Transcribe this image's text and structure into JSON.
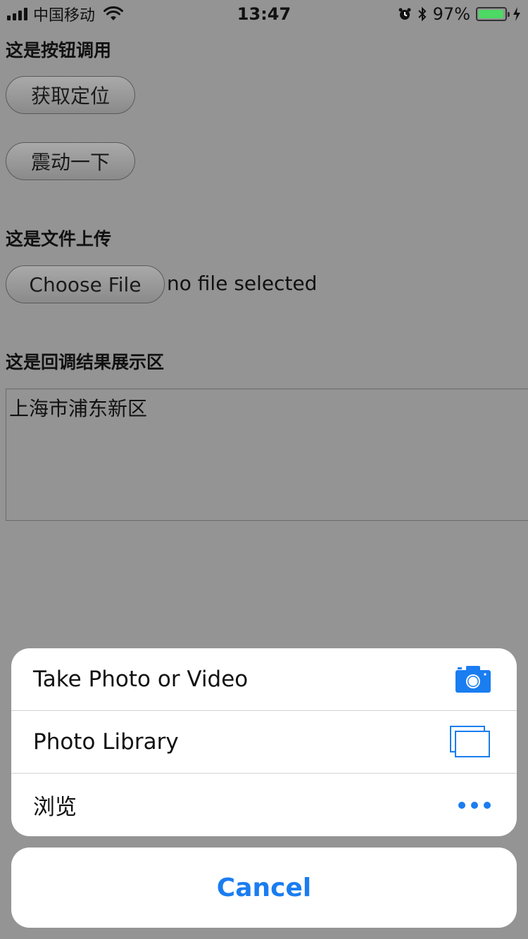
{
  "status_bar": {
    "carrier": "中国移动",
    "time": "13:47",
    "battery_percent_label": "97%",
    "battery_level": 0.97,
    "battery_color": "#4cd964"
  },
  "page": {
    "button_section_title": "这是按钮调用",
    "buttons": [
      {
        "label": "获取定位"
      },
      {
        "label": "震动一下"
      }
    ],
    "upload_section_title": "这是文件上传",
    "choose_file_label": "Choose File",
    "file_status": "no file selected",
    "result_section_title": "这是回调结果展示区",
    "result_text": "上海市浦东新区"
  },
  "action_sheet": {
    "items": [
      {
        "label": "Take Photo or Video",
        "icon": "camera-icon"
      },
      {
        "label": "Photo Library",
        "icon": "photo-library-icon"
      },
      {
        "label": "浏览",
        "icon": "more-dots-icon"
      }
    ],
    "cancel_label": "Cancel",
    "accent_color": "#1a7df0"
  }
}
